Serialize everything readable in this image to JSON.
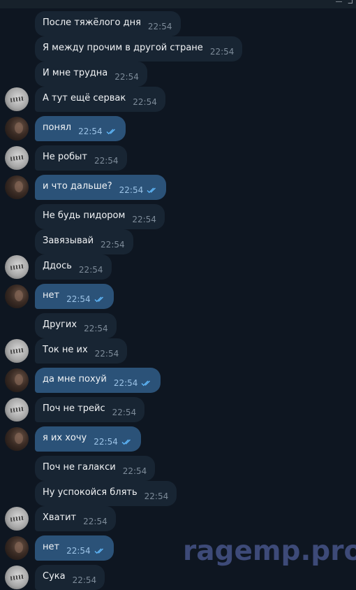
{
  "window": {
    "controls": "— ⊐"
  },
  "messages": [
    {
      "text": "После тяжёлого дня",
      "time": "22:54",
      "dir": "in"
    },
    {
      "text": "Я между прочим в другой стране",
      "time": "22:54",
      "dir": "in"
    },
    {
      "text": "И мне трудна",
      "time": "22:54",
      "dir": "in"
    },
    {
      "text": "А тут ещё сервак",
      "time": "22:54",
      "dir": "in"
    },
    {
      "text": "понял",
      "time": "22:54",
      "dir": "out",
      "status": "read"
    },
    {
      "text": "Не робыт",
      "time": "22:54",
      "dir": "in"
    },
    {
      "text": "и что дальше?",
      "time": "22:54",
      "dir": "out",
      "status": "read"
    },
    {
      "text": "Не будь пидором",
      "time": "22:54",
      "dir": "in"
    },
    {
      "text": "Завязывай",
      "time": "22:54",
      "dir": "in"
    },
    {
      "text": "Ддось",
      "time": "22:54",
      "dir": "in"
    },
    {
      "text": "нет",
      "time": "22:54",
      "dir": "out",
      "status": "read"
    },
    {
      "text": "Других",
      "time": "22:54",
      "dir": "in"
    },
    {
      "text": "Ток не их",
      "time": "22:54",
      "dir": "in"
    },
    {
      "text": "да мне похуй",
      "time": "22:54",
      "dir": "out",
      "status": "read"
    },
    {
      "text": "Поч не трейс",
      "time": "22:54",
      "dir": "in"
    },
    {
      "text": "я их хочу",
      "time": "22:54",
      "dir": "out",
      "status": "read"
    },
    {
      "text": "Поч не галакси",
      "time": "22:54",
      "dir": "in"
    },
    {
      "text": "Ну успокойся блять",
      "time": "22:54",
      "dir": "in"
    },
    {
      "text": "Хватит",
      "time": "22:54",
      "dir": "in"
    },
    {
      "text": "нет",
      "time": "22:54",
      "dir": "out",
      "status": "read"
    },
    {
      "text": "Сука",
      "time": "22:54",
      "dir": "in"
    }
  ],
  "watermark": "ragemp.pro",
  "colors": {
    "background": "#0e1621",
    "incoming_bubble": "#182533",
    "outgoing_bubble": "#2b5278",
    "read_check": "#5eb5f7"
  }
}
